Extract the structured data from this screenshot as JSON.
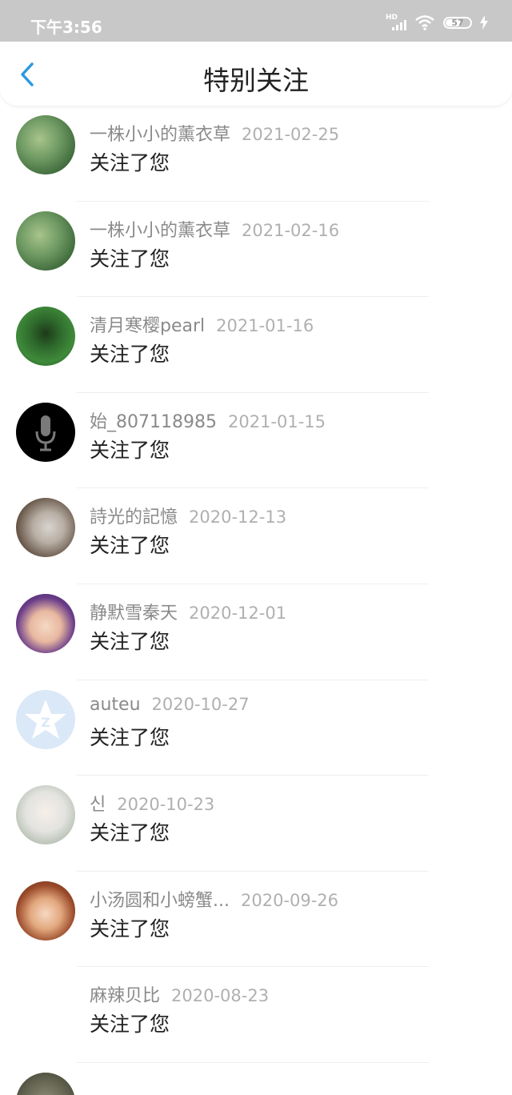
{
  "status": {
    "time": "下午3:56",
    "hd": "HD",
    "battery": "57"
  },
  "header": {
    "title": "特别关注"
  },
  "items": [
    {
      "name": "一株小小的薰衣草",
      "date": "2021-02-25",
      "action": "关注了您",
      "avatar": "lavender-avatar"
    },
    {
      "name": "一株小小的薰衣草",
      "date": "2021-02-16",
      "action": "关注了您",
      "avatar": "lavender-avatar"
    },
    {
      "name": "清月寒樱pearl",
      "date": "2021-01-16",
      "action": "关注了您",
      "avatar": "forest-avatar"
    },
    {
      "name": "始_807118985",
      "date": "2021-01-15",
      "action": "关注了您",
      "avatar": "microphone-avatar"
    },
    {
      "name": "詩光的記憶",
      "date": "2020-12-13",
      "action": "关注了您",
      "avatar": "jewelry-avatar"
    },
    {
      "name": "静默雪秦天",
      "date": "2020-12-01",
      "action": "关注了您",
      "avatar": "anime-girl-avatar"
    },
    {
      "name": "auteu",
      "date": "2020-10-27",
      "action": "关注了您",
      "avatar": "qzone-star-avatar"
    },
    {
      "name": "신",
      "date": "2020-10-23",
      "action": "关注了您",
      "avatar": "white-hair-avatar"
    },
    {
      "name": "小汤圆和小螃蟹...",
      "date": "2020-09-26",
      "action": "关注了您",
      "avatar": "anime-hat-avatar"
    },
    {
      "name": "麻辣贝比",
      "date": "2020-08-23",
      "action": "关注了您",
      "avatar": ""
    }
  ],
  "colors": {
    "accent": "#2a9ae0",
    "statusbar": "#c8c8c8"
  }
}
